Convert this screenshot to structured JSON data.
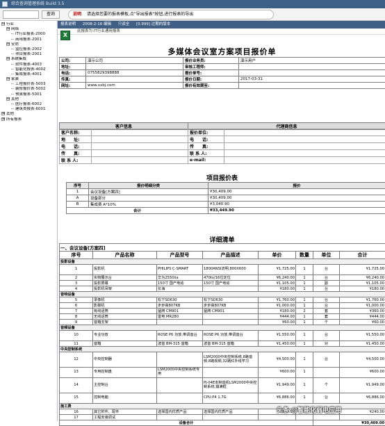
{
  "window": {
    "title": "综合查询管理系统 Build 3.5"
  },
  "search": {
    "value": "",
    "placeholder": "",
    "button": "查询"
  },
  "hint": {
    "tag": "说明",
    "text": "请选择您要的报表模板,点\"导出报表\"按钮,进行报表的导出"
  },
  "tree": [
    {
      "level": 0,
      "toggle": "⊟",
      "label": "行业"
    },
    {
      "level": 1,
      "toggle": "⊟",
      "label": "网络"
    },
    {
      "level": 2,
      "toggle": "",
      "label": "IT行业报表-2000"
    },
    {
      "level": 2,
      "toggle": "",
      "label": "商用报表-2001"
    },
    {
      "level": 1,
      "toggle": "⊟",
      "label": "安防"
    },
    {
      "level": 2,
      "toggle": "",
      "label": "监控报表-2002"
    },
    {
      "level": 2,
      "toggle": "",
      "label": "项目报表-2001"
    },
    {
      "level": 1,
      "toggle": "⊟",
      "label": "系统集成"
    },
    {
      "level": 2,
      "toggle": "",
      "label": "软件报表-4003"
    },
    {
      "level": 2,
      "toggle": "",
      "label": "智能化报表-4002"
    },
    {
      "level": 2,
      "toggle": "",
      "label": "集成报表-4001"
    },
    {
      "level": 1,
      "toggle": "⊟",
      "label": "家装"
    },
    {
      "level": 2,
      "toggle": "",
      "label": "工程报价表-5003"
    },
    {
      "level": 2,
      "toggle": "",
      "label": "装修报价表-5002"
    },
    {
      "level": 2,
      "toggle": "",
      "label": "预算报表-5001"
    },
    {
      "level": 1,
      "toggle": "⊟",
      "label": "其他"
    },
    {
      "level": 2,
      "toggle": "",
      "label": "医疗报表-6002"
    },
    {
      "level": 2,
      "toggle": "",
      "label": "建筑类报表-6001"
    },
    {
      "level": 0,
      "toggle": "⊞",
      "label": "其他"
    },
    {
      "level": 0,
      "toggle": "⊞",
      "label": "所有报表"
    }
  ],
  "report_toolbar": {
    "label": "报表说明",
    "date": "2008-2-16 编辑",
    "status": "只读全",
    "version": "[0.999] 过期的版本"
  },
  "report_title": "此报表为:IT行业通用报表",
  "doc": {
    "title": "多媒体会议室方案项目报价单",
    "info": [
      [
        "公司:",
        "演示公司",
        "报价业务员:",
        "演示用户"
      ],
      [
        "地址:",
        "",
        "审核工程师:",
        ""
      ],
      [
        "电话:",
        "0755829398888",
        "报价单号:",
        ""
      ],
      [
        "传真:",
        "",
        "报价日期:",
        "2017-03-31"
      ],
      [
        "网址:",
        "www.xxbj.com",
        "报价有效期至:",
        ""
      ]
    ],
    "cust_header": "客户信息",
    "agent_header": "代理商信息",
    "cust_rows": [
      [
        "客户名称:",
        "报价单位:"
      ],
      [
        "地　　址:",
        "电　　话:"
      ],
      [
        "电　　话:",
        "传　　真:"
      ],
      [
        "传　　真:",
        "联 系 人:"
      ],
      [
        "联 系 人:",
        "e-mail:"
      ]
    ],
    "quote_title": "项目报价表",
    "quote_headers": [
      "序号",
      "报价明细分类",
      "报价"
    ],
    "quote_rows": [
      [
        "1",
        "会议设备[方案四]",
        "¥30,409.00"
      ],
      [
        "A",
        "设备部分",
        "¥30,409.00"
      ],
      [
        "B",
        "集成费 A*10%",
        "¥3,040.90"
      ]
    ],
    "quote_total_label": "合计",
    "quote_total": "¥33,449.90",
    "detail_title": "详细清单",
    "detail_group": "一、会议设备[方案四]",
    "detail_headers": [
      "序号",
      "产品名称",
      "产品型号",
      "产品描述",
      "单价",
      "数量",
      "单位",
      "合计"
    ],
    "detail_sections": [
      {
        "name": "投影设备",
        "rows": [
          [
            "1",
            "投影机",
            "PHILIPS C-SMART",
            "1800ANSI流明,800X600",
            "¥1,725.00",
            "1",
            "台",
            "¥1,725.00"
          ],
          [
            "2",
            "实物展示台",
            "华为2550iia",
            "470tv/16位定位",
            "¥6,240.00",
            "1",
            "台",
            "¥6,240.00"
          ],
          [
            "3",
            "投影屏幕",
            "150寸 国产电动",
            "150寸 国产电动",
            "¥1,105.00",
            "1",
            "副",
            "¥1,105.00"
          ],
          [
            "4",
            "投影机吊架",
            "长海",
            "",
            "¥180.00",
            "1",
            "台",
            "¥180.00"
          ]
        ]
      },
      {
        "name": "音响设备",
        "rows": [
          [
            "5",
            "录像机",
            "松下SD630",
            "松下SD630",
            "¥1,760.00",
            "1",
            "台",
            "¥1,760.00"
          ],
          [
            "6",
            "影碟机",
            "步步高807KB",
            "步步高807KB",
            "¥1,000.00",
            "1",
            "台",
            "¥1,000.00"
          ],
          [
            "7",
            "有线话筒",
            "猛牌 CM901",
            "猛牌 CM901",
            "¥180.00",
            "2",
            "套",
            "¥360.00"
          ],
          [
            "8",
            "无线话筒",
            "雷电 MR280",
            "",
            "¥444.00",
            "1",
            "套",
            "¥444.00"
          ],
          [
            "9",
            "音箱支架",
            "",
            "",
            "¥60.00",
            "1",
            "个",
            "¥60.00"
          ]
        ]
      },
      {
        "name": "音频设备",
        "rows": [
          [
            "10",
            "专业功放",
            "ROSE P6 功放,带调音台",
            "ROSE P6 功放,带调音台",
            "¥1,550.00",
            "1",
            "台",
            "¥1,550.00"
          ],
          [
            "11",
            "音箱",
            "波音 BM-315 音箱",
            "波音 BM-315 音箱",
            "¥1,450.00",
            "1",
            "对",
            "¥1,450.00"
          ]
        ]
      },
      {
        "name": "中央控制系统",
        "rows": [
          [
            "12",
            "中央控制器",
            "",
            "LSM2000中央控制系统,8路音频,8路视频,32路红外线学习",
            "¥4,500.00",
            "1",
            "台",
            "¥4,500.00"
          ],
          [
            "13",
            "专用控制盘",
            "LSM2000中央控制系统专用",
            "",
            "¥600.00",
            "1",
            "",
            "¥600.00"
          ],
          [
            "14",
            "主控制台",
            "",
            "PJ-04E本制造机LSM2000中央控制系统,镶满框",
            "¥1,949.00",
            "1",
            "个",
            "¥1,949.00"
          ],
          [
            "15",
            "控制电脑",
            "",
            "CPU:P4 1.7G",
            "¥6,886.00",
            "1",
            "台",
            "¥6,886.00"
          ]
        ]
      },
      {
        "name": "施工费",
        "rows": [
          [
            "16",
            "其它附件、配件",
            "选择国内优质产品",
            "选择国内优质产品",
            "¥240.00",
            "1",
            "批",
            "¥240.00"
          ],
          [
            "17",
            "工程安装调试",
            "",
            "",
            "",
            "",
            "",
            ""
          ]
        ]
      }
    ],
    "detail_total_label": "设备合计",
    "detail_total": "¥30,409.00"
  },
  "watermark": "头条 @智能化弱电应用"
}
